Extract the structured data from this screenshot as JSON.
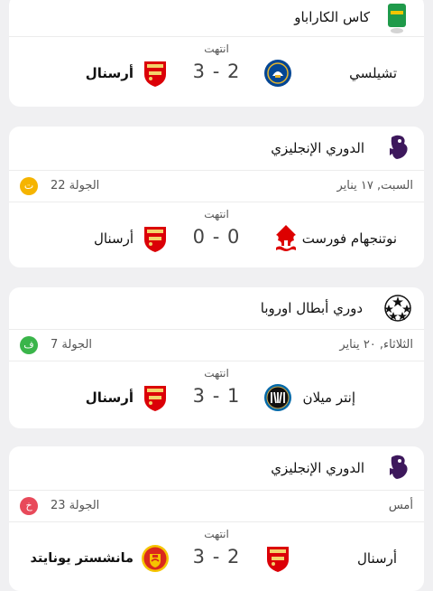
{
  "cards": [
    {
      "competition": "كاس الكاراباو",
      "match": {
        "status": "انتهت",
        "score": "3 - 2",
        "home_team": "تشيلسي",
        "away_team": "أرسنال"
      }
    },
    {
      "competition": "الدوري الإنجليزي",
      "date": "السبت, ١٧ يناير",
      "round": "الجولة 22",
      "badge": "ت",
      "match": {
        "status": "انتهت",
        "score": "0 - 0",
        "home_team": "نوتنجهام فورست",
        "away_team": "أرسنال"
      }
    },
    {
      "competition": "دوري أبطال اوروبا",
      "date": "الثلاثاء, ٢٠ يناير",
      "round": "الجولة 7",
      "badge": "ف",
      "match": {
        "status": "انتهت",
        "score": "3 - 1",
        "home_team": "إنتر ميلان",
        "away_team": "أرسنال"
      }
    },
    {
      "competition": "الدوري الإنجليزي",
      "date": "أمس",
      "round": "الجولة 23",
      "badge": "خ",
      "match": {
        "status": "انتهت",
        "score": "3 - 2",
        "home_team": "أرسنال",
        "away_team": "مانشستر يونايتد"
      }
    }
  ],
  "colors": {
    "badge_draw": "#f5b400",
    "badge_win": "#3ab54a",
    "badge_loss": "#e8495a",
    "arsenal_red": "#db0007",
    "chelsea_blue": "#034694",
    "inter_blue": "#0068a8",
    "forest_red": "#dd0000",
    "premier_purple": "#3d185c"
  },
  "icons": [
    "carabao-cup-icon",
    "premier-league-icon",
    "champions-league-icon",
    "arsenal-crest-icon",
    "chelsea-crest-icon",
    "nottingham-forest-crest-icon",
    "inter-milan-crest-icon",
    "manchester-united-crest-icon"
  ]
}
